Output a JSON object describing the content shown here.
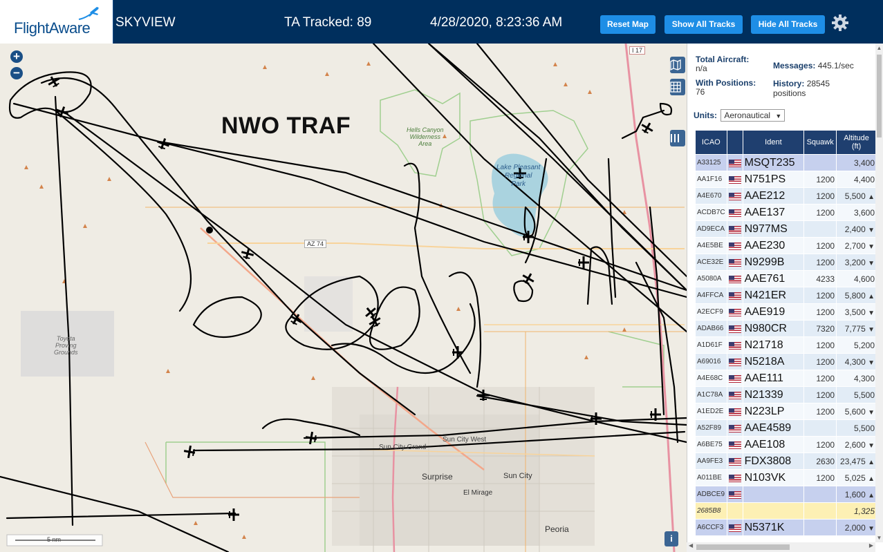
{
  "header": {
    "logo_text": "FlightAware",
    "site_name": "SKYVIEW",
    "ta_tracked": "TA Tracked: 89",
    "datetime": "4/28/2020, 8:23:36 AM",
    "buttons": {
      "reset": "Reset Map",
      "show_all": "Show All Tracks",
      "hide_all": "Hide All Tracks"
    }
  },
  "map": {
    "overlay_title": "NWO TRAF",
    "zoom_in": "+",
    "zoom_out": "−",
    "scale_label": "5 nm",
    "info_label": "i",
    "place_labels": {
      "hells_canyon": [
        "Hells Canyon",
        "Wilderness",
        "Area"
      ],
      "lake_pleasant": [
        "Lake Pleasant",
        "Regional",
        "Park"
      ],
      "toyota": [
        "Toyota",
        "Proving",
        "Grounds"
      ],
      "sun_city_grand": "Sun City Grand",
      "sun_city_west": "Sun City West",
      "surprise": "Surprise",
      "sun_city": "Sun City",
      "el_mirage": "El Mirage",
      "peoria": "Peoria"
    },
    "road_labels": {
      "az74": "AZ 74",
      "i17": "I 17"
    }
  },
  "stats": {
    "total_aircraft_label": "Total Aircraft:",
    "total_aircraft_value": "n/a",
    "with_positions_label": "With Positions:",
    "with_positions_value": "76",
    "messages_label": "Messages:",
    "messages_value": "445.1/sec",
    "history_label": "History:",
    "history_value": "28545",
    "history_unit": "positions",
    "units_label": "Units:",
    "units_value": "Aeronautical"
  },
  "table": {
    "headers": {
      "icao": "ICAO",
      "ident": "Ident",
      "squawk": "Squawk",
      "altitude": "Altitude",
      "altitude_unit": "(ft)"
    },
    "rows": [
      {
        "icao": "A33125",
        "ident": "MSQT235",
        "squawk": "",
        "alt": "3,400",
        "trend": ""
      },
      {
        "icao": "AA1F16",
        "ident": "N751PS",
        "squawk": "1200",
        "alt": "4,400",
        "trend": ""
      },
      {
        "icao": "A4E670",
        "ident": "AAE212",
        "squawk": "1200",
        "alt": "5,500",
        "trend": "▲"
      },
      {
        "icao": "ACDB7C",
        "ident": "AAE137",
        "squawk": "1200",
        "alt": "3,600",
        "trend": ""
      },
      {
        "icao": "AD9ECA",
        "ident": "N977MS",
        "squawk": "",
        "alt": "2,400",
        "trend": "▼"
      },
      {
        "icao": "A4E5BE",
        "ident": "AAE230",
        "squawk": "1200",
        "alt": "2,700",
        "trend": "▼"
      },
      {
        "icao": "ACE32E",
        "ident": "N9299B",
        "squawk": "1200",
        "alt": "3,200",
        "trend": "▼"
      },
      {
        "icao": "A5080A",
        "ident": "AAE761",
        "squawk": "4233",
        "alt": "4,600",
        "trend": ""
      },
      {
        "icao": "A4FFCA",
        "ident": "N421ER",
        "squawk": "1200",
        "alt": "5,800",
        "trend": "▲"
      },
      {
        "icao": "A2ECF9",
        "ident": "AAE919",
        "squawk": "1200",
        "alt": "3,500",
        "trend": "▼"
      },
      {
        "icao": "ADAB66",
        "ident": "N980CR",
        "squawk": "7320",
        "alt": "7,775",
        "trend": "▼"
      },
      {
        "icao": "A1D61F",
        "ident": "N21718",
        "squawk": "1200",
        "alt": "5,200",
        "trend": ""
      },
      {
        "icao": "A69016",
        "ident": "N5218A",
        "squawk": "1200",
        "alt": "4,300",
        "trend": "▼"
      },
      {
        "icao": "A4E68C",
        "ident": "AAE111",
        "squawk": "1200",
        "alt": "4,300",
        "trend": ""
      },
      {
        "icao": "A1C78A",
        "ident": "N21339",
        "squawk": "1200",
        "alt": "5,500",
        "trend": ""
      },
      {
        "icao": "A1ED2E",
        "ident": "N223LP",
        "squawk": "1200",
        "alt": "5,600",
        "trend": "▼"
      },
      {
        "icao": "A52F89",
        "ident": "AAE4589",
        "squawk": "",
        "alt": "5,500",
        "trend": ""
      },
      {
        "icao": "A6BE75",
        "ident": "AAE108",
        "squawk": "1200",
        "alt": "2,600",
        "trend": "▼"
      },
      {
        "icao": "AA9FE3",
        "ident": "FDX3808",
        "squawk": "2630",
        "alt": "23,475",
        "trend": "▲"
      },
      {
        "icao": "A011BE",
        "ident": "N103VK",
        "squawk": "1200",
        "alt": "5,025",
        "trend": "▲"
      },
      {
        "icao": "ADBCE9",
        "ident": "",
        "squawk": "",
        "alt": "1,600",
        "trend": "▲"
      },
      {
        "icao": "2685B8",
        "ident": "",
        "squawk": "",
        "alt": "1,325",
        "trend": ""
      },
      {
        "icao": "A6CCF3",
        "ident": "N5371K",
        "squawk": "",
        "alt": "2,000",
        "trend": "▼"
      }
    ]
  },
  "colors": {
    "header_bg": "#002f5d",
    "button_blue": "#1e8ee6",
    "table_header": "#1f3f6f"
  }
}
